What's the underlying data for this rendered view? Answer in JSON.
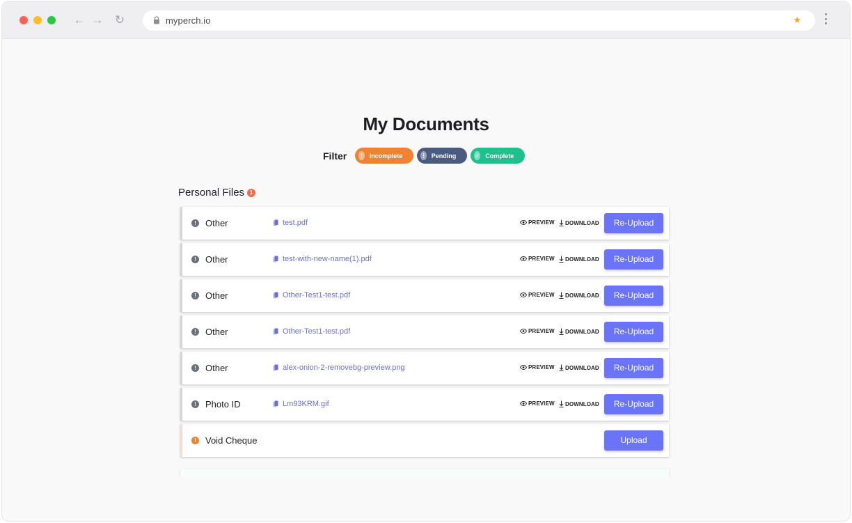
{
  "browser": {
    "url": "myperch.io",
    "back_icon": "←",
    "forward_icon": "→",
    "reload_icon": "↻",
    "star_icon": "★"
  },
  "page": {
    "title": "My Documents",
    "filter_label": "Filter",
    "filters": [
      {
        "label": "Incomplete",
        "icon": "!",
        "color": "#f08232"
      },
      {
        "label": "Pending",
        "icon": "⋮",
        "color": "#4a5a80"
      },
      {
        "label": "Complete",
        "icon": "✓",
        "color": "#1ec18c"
      }
    ],
    "section": {
      "title": "Personal Files",
      "badge_count": "1"
    },
    "actions": {
      "preview": "PREVIEW",
      "download": "DOWNLOAD"
    },
    "rows": [
      {
        "type": "Other",
        "status_icon": "!",
        "file": "test.pdf",
        "button": "Re-Upload"
      },
      {
        "type": "Other",
        "status_icon": "!",
        "file": "test-with-new-name(1).pdf",
        "button": "Re-Upload"
      },
      {
        "type": "Other",
        "status_icon": "!",
        "file": "Other-Test1-test.pdf",
        "button": "Re-Upload"
      },
      {
        "type": "Other",
        "status_icon": "!",
        "file": "Other-Test1-test.pdf",
        "button": "Re-Upload"
      },
      {
        "type": "Other",
        "status_icon": "!",
        "file": "alex-onion-2-removebg-preview.png",
        "button": "Re-Upload"
      },
      {
        "type": "Photo ID",
        "status_icon": "!",
        "file": "Lm93KRM.gif",
        "button": "Re-Upload"
      },
      {
        "type": "Void Cheque",
        "status_icon": "!",
        "file": "",
        "button": "Upload"
      }
    ]
  }
}
